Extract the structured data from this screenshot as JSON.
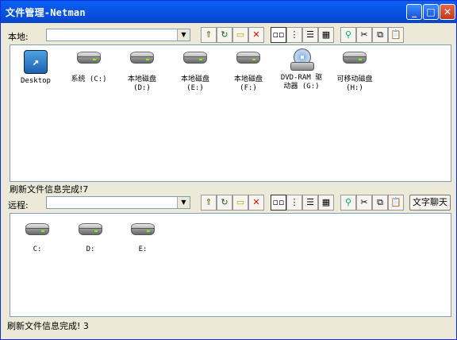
{
  "window": {
    "title": "文件管理-Netman"
  },
  "local": {
    "label": "本地:",
    "path_value": "",
    "items": [
      {
        "label": "Desktop",
        "icon": "desktop-icon"
      },
      {
        "label": "系统 (C:)",
        "icon": "drive-icon"
      },
      {
        "label": "本地磁盘\n(D:)",
        "icon": "drive-icon"
      },
      {
        "label": "本地磁盘\n(E:)",
        "icon": "drive-icon"
      },
      {
        "label": "本地磁盘\n(F:)",
        "icon": "drive-icon"
      },
      {
        "label": "DVD-RAM 驱\n动器 (G:)",
        "icon": "dvd-drive-icon"
      },
      {
        "label": "可移动磁盘\n(H:)",
        "icon": "drive-icon"
      }
    ],
    "status": "刷新文件信息完成!7"
  },
  "remote": {
    "label": "远程:",
    "path_value": "",
    "items": [
      {
        "label": "C:",
        "icon": "drive-icon"
      },
      {
        "label": "D:",
        "icon": "drive-icon"
      },
      {
        "label": "E:",
        "icon": "drive-icon"
      }
    ],
    "chat_button": "文字聊天",
    "status": "刷新文件信息完成! 3"
  },
  "toolbar": {
    "icons": [
      "up-folder-icon",
      "refresh-icon",
      "new-folder-icon",
      "delete-icon",
      "large-icons-view-icon",
      "small-icons-view-icon",
      "list-view-icon",
      "details-view-icon",
      "search-icon",
      "cut-icon",
      "copy-icon",
      "paste-icon"
    ]
  },
  "colors": {
    "titlebar": "#0A5FF2",
    "window_bg": "#ECE9D8",
    "panel_border": "#7F9DB9"
  }
}
